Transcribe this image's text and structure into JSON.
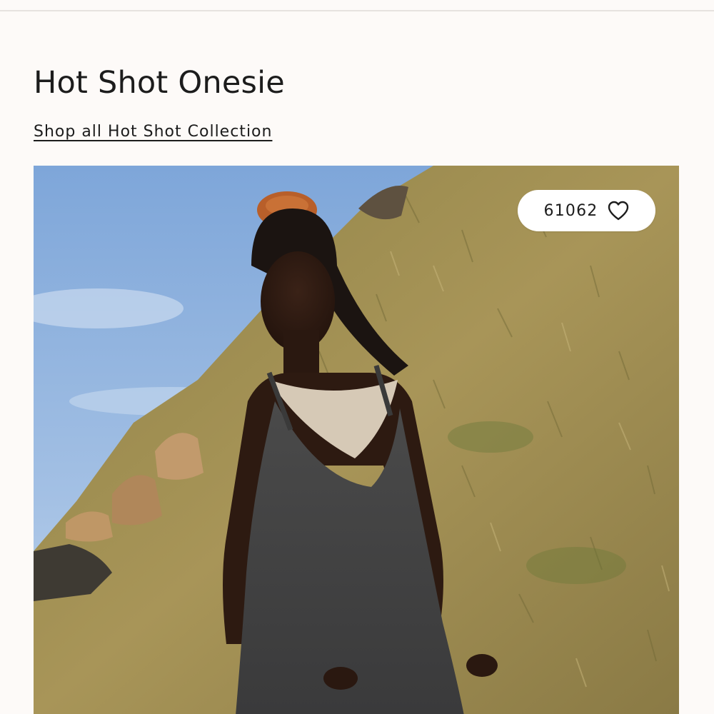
{
  "product": {
    "title": "Hot Shot Onesie",
    "collection_link": "Shop all Hot Shot Collection"
  },
  "image": {
    "alt": "Model in a charcoal onesie over a ribbed bralette on a grassy hillside",
    "favorites": {
      "count": "61062",
      "icon": "heart-outline-icon"
    }
  },
  "colors": {
    "background": "#fdfaf8",
    "text": "#1c1c1c"
  }
}
